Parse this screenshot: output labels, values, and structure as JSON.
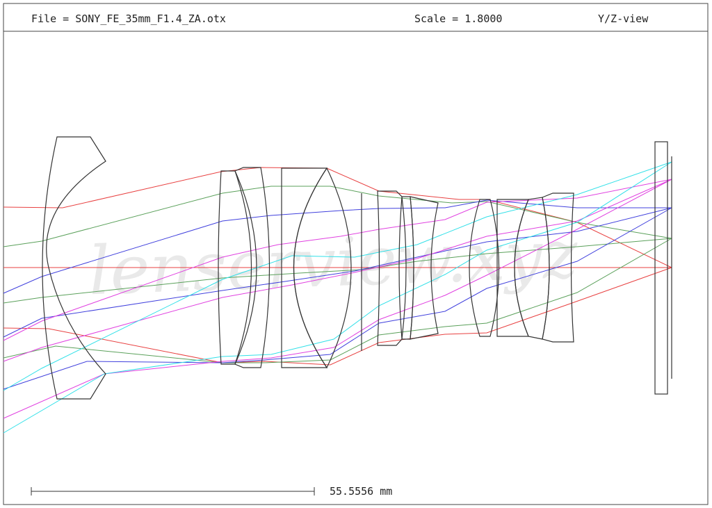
{
  "header": {
    "file_label": "File = SONY_FE_35mm_F1.4_ZA.otx",
    "scale_label": "Scale = 1.8000",
    "view_label": "Y/Z-view"
  },
  "watermark": "lenserview.xyz",
  "scale_bar": {
    "label": "55.5556 mm"
  },
  "ray_colors": {
    "red": "#e84040",
    "green": "#5aa05a",
    "blue": "#4040dd",
    "magenta": "#e040e0",
    "cyan": "#30e0e8"
  }
}
